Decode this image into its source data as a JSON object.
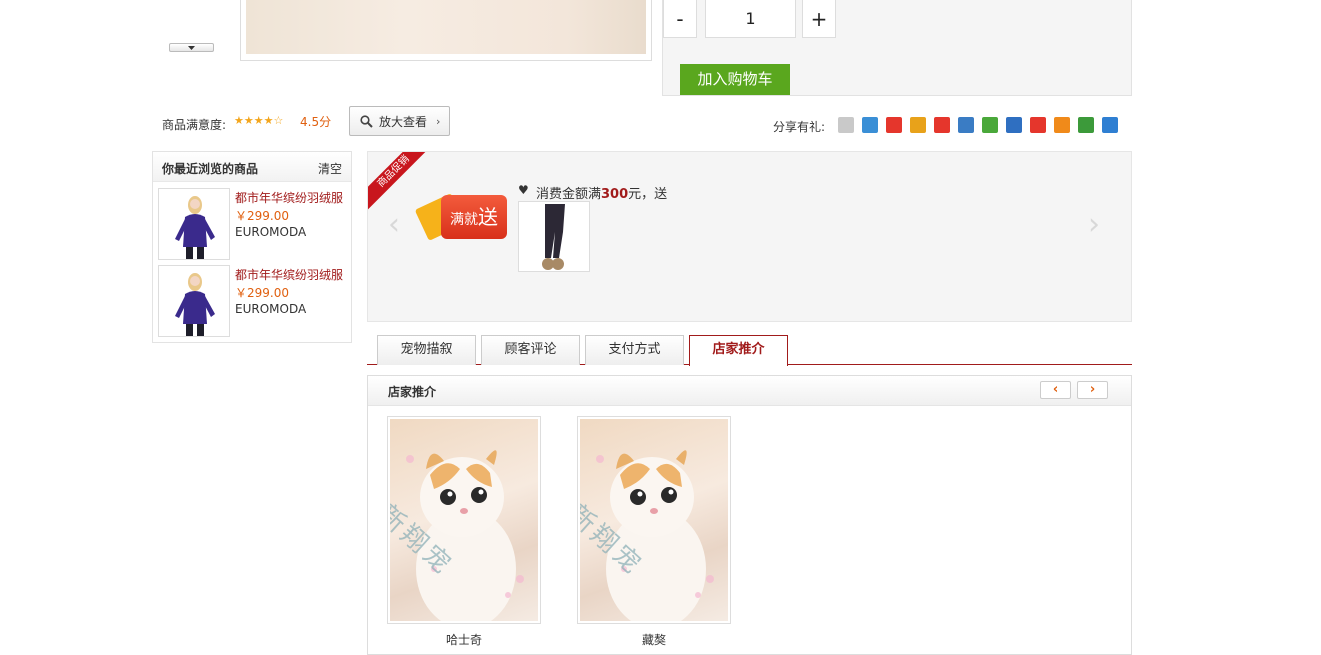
{
  "purchase": {
    "quantity": "1",
    "minus": "-",
    "plus": "+",
    "add_to_cart": "加入购物车"
  },
  "rating": {
    "label": "商品满意度:",
    "score_value": 4.5,
    "score_text": "4.5分",
    "star_icon": "star-icon"
  },
  "zoom_button": {
    "label": "放大查看"
  },
  "share": {
    "label": "分享有礼:",
    "icons": [
      {
        "name": "qzone-icon",
        "color": "#c9c9c9"
      },
      {
        "name": "pengyou-icon",
        "color": "#3a8fd6"
      },
      {
        "name": "weibo-icon",
        "color": "#e5362c"
      },
      {
        "name": "tianya-icon",
        "color": "#e8a21a"
      },
      {
        "name": "renren-icon",
        "color": "#e5362c"
      },
      {
        "name": "favorites-icon",
        "color": "#3a7cc4"
      },
      {
        "name": "kaixin-icon",
        "color": "#4aa83a"
      },
      {
        "name": "renren-blue-icon",
        "color": "#2f6fc1"
      },
      {
        "name": "star-share-icon",
        "color": "#e5362c"
      },
      {
        "name": "taobao-icon",
        "color": "#f08a1a"
      },
      {
        "name": "douban-icon",
        "color": "#3c9a3a"
      },
      {
        "name": "baidu-icon",
        "color": "#2f7fd2"
      }
    ]
  },
  "recent": {
    "title": "你最近浏览的商品",
    "clear": "清空",
    "items": [
      {
        "name": "都市年华缤纷羽绒服",
        "price": "￥299.00",
        "brand": "EUROMODA"
      },
      {
        "name": "都市年华缤纷羽绒服",
        "price": "￥299.00",
        "brand": "EUROMODA"
      }
    ]
  },
  "promo": {
    "ribbon": "商品促销",
    "badge_small": "满就",
    "badge_big": "送",
    "badge_side": "满",
    "text_prefix": "消费金额满",
    "amount": "300",
    "text_suffix": "元，送",
    "heart": "♥"
  },
  "tabs": [
    {
      "label": "宠物描叙",
      "active": false
    },
    {
      "label": "顾客评论",
      "active": false
    },
    {
      "label": "支付方式",
      "active": false
    },
    {
      "label": "店家推介",
      "active": true
    }
  ],
  "recommend": {
    "title": "店家推介",
    "prev": "‹",
    "next": "›",
    "items": [
      {
        "name": "哈士奇"
      },
      {
        "name": "藏獒"
      }
    ]
  },
  "colors": {
    "accent": "#a11b1b",
    "price": "#e06010",
    "cart_green": "#5aa71e"
  }
}
